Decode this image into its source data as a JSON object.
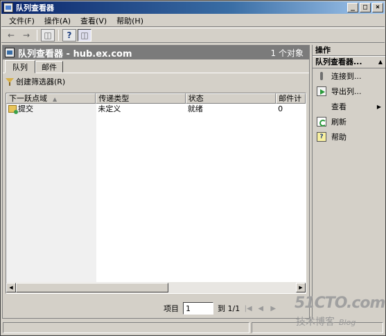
{
  "window": {
    "title": "队列查看器"
  },
  "menu": [
    "文件(F)",
    "操作(A)",
    "查看(V)",
    "帮助(H)"
  ],
  "header": {
    "title": "队列查看器 - hub.ex.com",
    "count": "1 个对象"
  },
  "tabs": [
    "队列",
    "邮件"
  ],
  "create_filter_label": "创建筛选器(R)",
  "grid": {
    "columns": [
      "下一跃点域",
      "传递类型",
      "状态",
      "邮件计"
    ],
    "rows": [
      {
        "next_hop": "提交",
        "delivery_type": "未定义",
        "status": "就绪",
        "message_count": "0"
      }
    ]
  },
  "pager": {
    "label": "项目",
    "value": "1",
    "of_label": "到 1/1"
  },
  "actions": {
    "header": "操作",
    "section": "队列查看器...",
    "items": [
      {
        "label": "连接到...",
        "icon": "connect-icon"
      },
      {
        "label": "导出列...",
        "icon": "export-icon"
      },
      {
        "label": "查看",
        "icon": "none",
        "submenu": true
      },
      {
        "label": "刷新",
        "icon": "refresh-icon"
      },
      {
        "label": "帮助",
        "icon": "help-icon"
      }
    ]
  },
  "watermark": {
    "site": "51CTO.com",
    "sub": "技术博客",
    "blog": "Blog"
  }
}
